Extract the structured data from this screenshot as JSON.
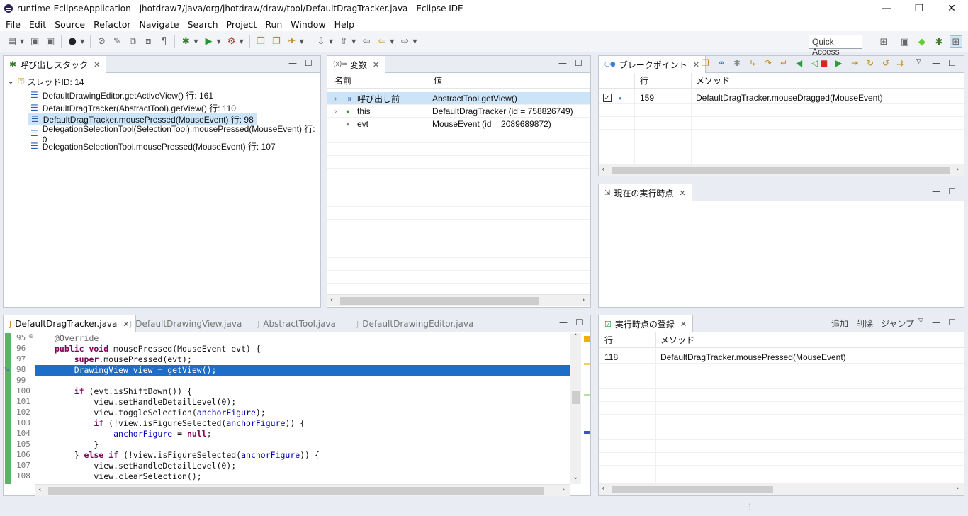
{
  "window": {
    "title": "runtime-EclipseApplication - jhotdraw7/java/org/jhotdraw/draw/tool/DefaultDragTracker.java - Eclipse IDE",
    "minimize": "—",
    "restore": "❐",
    "close": "✕"
  },
  "menu": [
    "File",
    "Edit",
    "Source",
    "Refactor",
    "Navigate",
    "Search",
    "Project",
    "Run",
    "Window",
    "Help"
  ],
  "toolbar": {
    "quick_access": "Quick Access"
  },
  "callstack": {
    "tab_label": "呼び出しスタック",
    "thread": "スレッドID: 14",
    "frames": [
      "DefaultDrawingEditor.getActiveView() 行: 161",
      "DefaultDragTracker(AbstractTool).getView() 行: 110",
      "DefaultDragTracker.mousePressed(MouseEvent) 行: 98",
      "DelegationSelectionTool(SelectionTool).mousePressed(MouseEvent) 行: 0",
      "DelegationSelectionTool.mousePressed(MouseEvent) 行: 107"
    ],
    "selected_index": 2
  },
  "variables": {
    "tab_icon": "(x)=",
    "tab_label": "変数",
    "col_name": "名前",
    "col_value": "値",
    "rows": [
      {
        "name": "呼び出し前",
        "value": "AbstractTool.getView()"
      },
      {
        "name": "this",
        "value": "DefaultDragTracker (id = 758826749)"
      },
      {
        "name": "evt",
        "value": "MouseEvent (id = 2089689872)"
      }
    ]
  },
  "breakpoints": {
    "tab_label": "ブレークポイント",
    "col_line": "行",
    "col_method": "メソッド",
    "rows": [
      {
        "line": "159",
        "method": "DefaultDragTracker.mouseDragged(MouseEvent)"
      }
    ]
  },
  "current_point": {
    "tab_label": "現在の実行時点"
  },
  "editor": {
    "tabs": [
      "DefaultDragTracker.java",
      "DefaultDrawingView.java",
      "AbstractTool.java",
      "DefaultDrawingEditor.java"
    ],
    "line_numbers": [
      "95",
      "96",
      "97",
      "98",
      "99",
      "100",
      "101",
      "102",
      "103",
      "104",
      "105",
      "106",
      "107",
      "108"
    ]
  },
  "registered_points": {
    "tab_label": "実行時点の登録",
    "add": "追加",
    "delete": "削除",
    "jump": "ジャンプ",
    "col_line": "行",
    "col_method": "メソッド",
    "rows": [
      {
        "line": "118",
        "method": "DefaultDragTracker.mousePressed(MouseEvent)"
      }
    ]
  }
}
